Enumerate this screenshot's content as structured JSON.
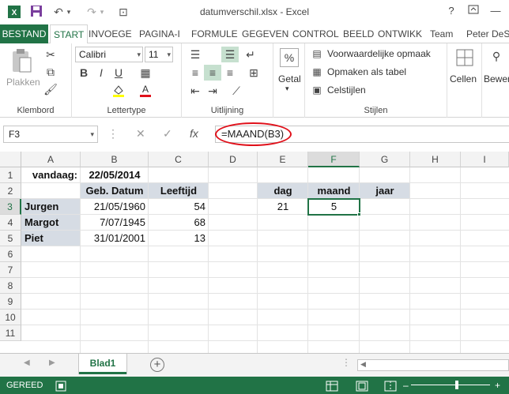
{
  "window": {
    "title": "datumverschil.xlsx - Excel",
    "help": "?",
    "minimize": "—",
    "restore": "❐"
  },
  "quick_access": {
    "save": "💾",
    "undo": "↶",
    "undo_dd": "▾",
    "redo": "↷",
    "redo_dd": "▾",
    "extra": "⊡"
  },
  "tabs": [
    {
      "label": "BESTAND"
    },
    {
      "label": "START"
    },
    {
      "label": "INVOEGE"
    },
    {
      "label": "PAGINA-I"
    },
    {
      "label": "FORMULE"
    },
    {
      "label": "GEGEVEN"
    },
    {
      "label": "CONTROL"
    },
    {
      "label": "BEELD"
    },
    {
      "label": "ONTWIKK"
    },
    {
      "label": "Team"
    },
    {
      "label": "Peter DeS..."
    }
  ],
  "ribbon": {
    "klembord": {
      "label": "Klembord",
      "paste": "Plakken"
    },
    "lettertype": {
      "label": "Lettertype",
      "font": "Calibri",
      "size": "11",
      "bold": "B",
      "italic": "I",
      "underline": "U",
      "grow": "A",
      "shrink": "A",
      "fill": "A"
    },
    "uitlijning": {
      "label": "Uitlijning"
    },
    "getal": {
      "label": "Getal",
      "symbol": "%"
    },
    "stijlen": {
      "label": "Stijlen",
      "cond_format": "Voorwaardelijke opmaak",
      "as_table": "Opmaken als tabel",
      "cell_styles": "Celstijlen"
    },
    "cellen": {
      "label": "Cellen"
    },
    "bewerken": {
      "label": "Bewer"
    }
  },
  "formula_bar": {
    "name_box": "F3",
    "cancel": "✕",
    "confirm": "✓",
    "fx": "fx",
    "formula": "=MAAND(B3)"
  },
  "sheet": {
    "columns": [
      "A",
      "B",
      "C",
      "D",
      "E",
      "F",
      "G",
      "H",
      "I"
    ],
    "rows": [
      "1",
      "2",
      "3",
      "4",
      "5",
      "6",
      "7",
      "8",
      "9",
      "10",
      "11"
    ],
    "cells": {
      "A1": "vandaag:",
      "B1": "22/05/2014",
      "B2": "Geb. Datum",
      "C2": "Leeftijd",
      "A3": "Jurgen",
      "B3": "21/05/1960",
      "C3": "54",
      "A4": "Margot",
      "B4": "7/07/1945",
      "C4": "68",
      "A5": "Piet",
      "B5": "31/01/2001",
      "C5": "13",
      "E2": "dag",
      "F2": "maand",
      "G2": "jaar",
      "E3": "21",
      "F3": "5"
    },
    "selected": "F3"
  },
  "sheet_tabs": {
    "active": "Blad1",
    "add": "+"
  },
  "status": {
    "text": "GEREED"
  },
  "colors": {
    "accent": "#217346",
    "header_shade": "#d6dce4",
    "formula_highlight": "#e0101a"
  }
}
